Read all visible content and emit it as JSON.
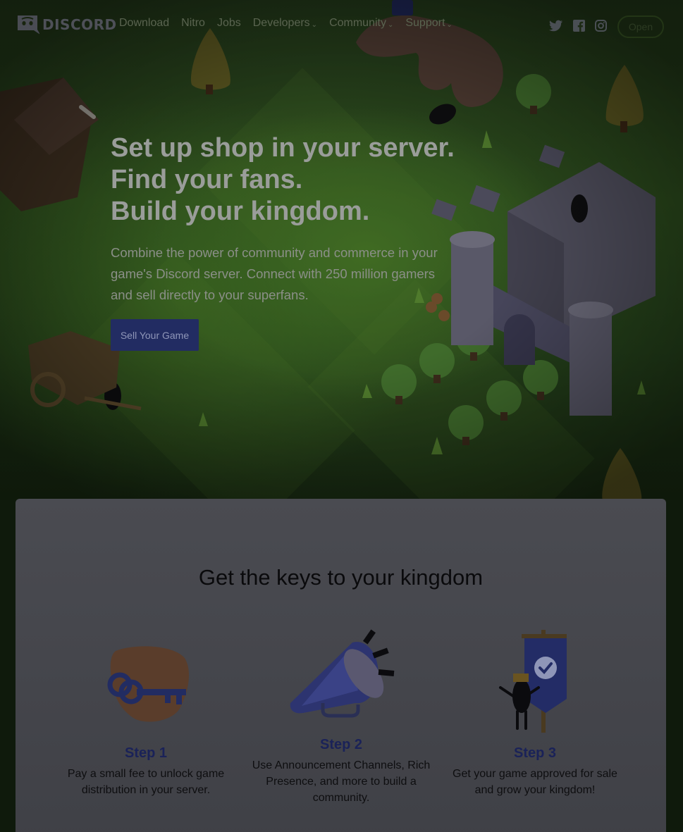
{
  "nav": {
    "logo_text": "DISCORD",
    "links": [
      {
        "label": "Download",
        "dropdown": false
      },
      {
        "label": "Nitro",
        "dropdown": false
      },
      {
        "label": "Jobs",
        "dropdown": false
      },
      {
        "label": "Developers",
        "dropdown": true
      },
      {
        "label": "Community",
        "dropdown": true
      },
      {
        "label": "Support",
        "dropdown": true
      }
    ],
    "social_icons": [
      "twitter-icon",
      "facebook-icon",
      "instagram-icon"
    ],
    "open_button": "Open"
  },
  "hero": {
    "title_lines": [
      "Set up shop in your server.",
      "Find your fans.",
      "Build your kingdom."
    ],
    "subtitle": "Combine the power of community and commerce in your game's Discord server. Connect with 250 million gamers and sell directly to your superfans.",
    "cta_label": "Sell Your Game"
  },
  "keys_section": {
    "title": "Get the keys to your kingdom",
    "steps": [
      {
        "title": "Step 1",
        "description": "Pay a small fee to unlock game distribution in your server.",
        "icon": "hand-with-key-icon"
      },
      {
        "title": "Step 2",
        "description": "Use Announcement Channels, Rich Presence, and more to build a community.",
        "icon": "megaphone-icon"
      },
      {
        "title": "Step 3",
        "description": "Get your game approved for sale and grow your kingdom!",
        "icon": "banner-icon"
      }
    ]
  },
  "colors": {
    "cta_background": "#222c62",
    "step_title": "#1a2258",
    "hero_grass": "#2b4a1c",
    "section_background": "#4a4b51"
  }
}
